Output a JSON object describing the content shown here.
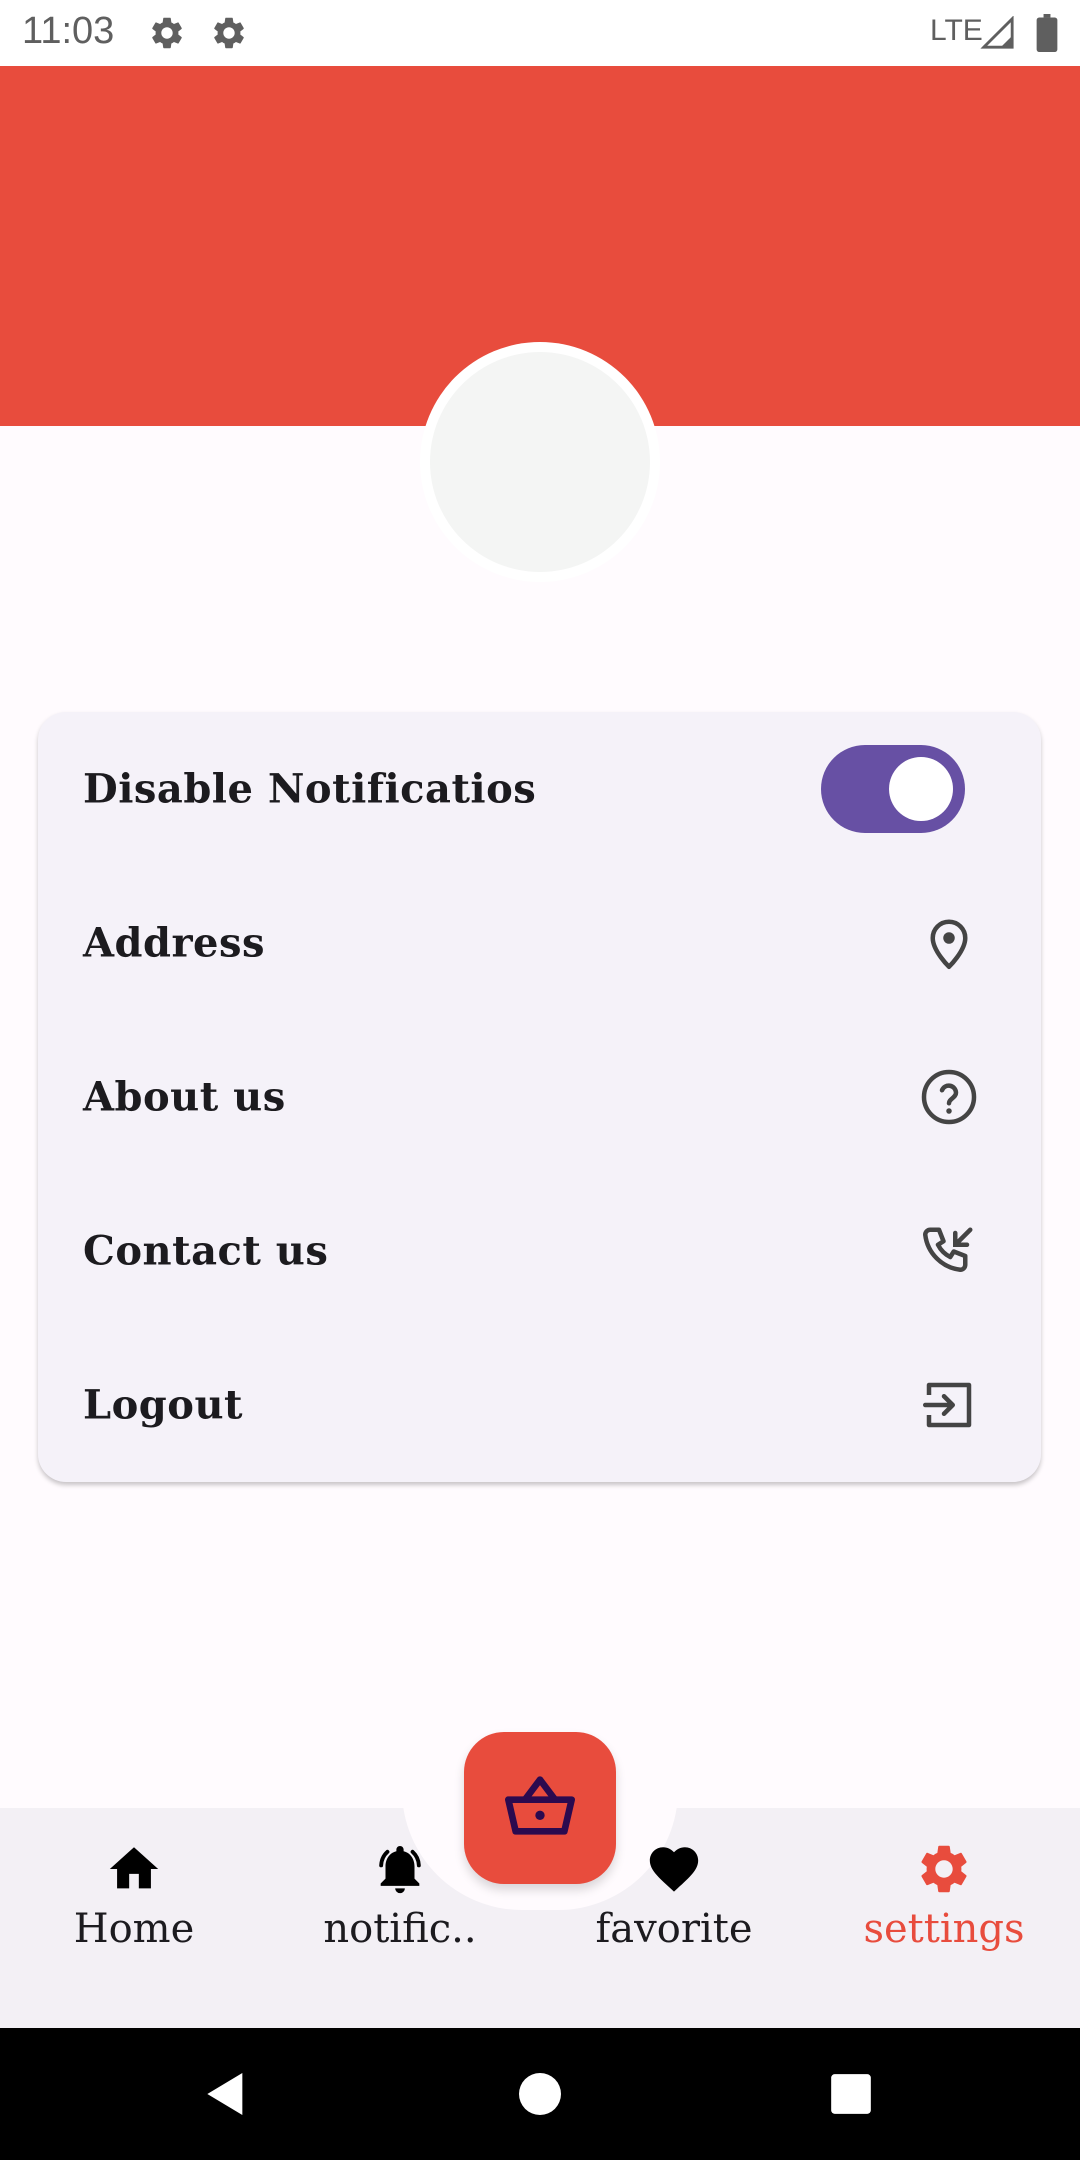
{
  "status_bar": {
    "time": "11:03",
    "network": "LTE"
  },
  "colors": {
    "accent": "#e84c3d",
    "toggle_on": "#6750a4",
    "card_bg": "#f5f2f9",
    "nav_bg": "#f3f0f5"
  },
  "settings": {
    "items": [
      {
        "label": "Disable Notificatios",
        "control": "toggle",
        "toggle_on": true
      },
      {
        "label": "Address",
        "icon": "location-pin-icon"
      },
      {
        "label": "About us",
        "icon": "help-circle-icon"
      },
      {
        "label": "Contact us",
        "icon": "phone-incoming-icon"
      },
      {
        "label": "Logout",
        "icon": "logout-icon"
      }
    ]
  },
  "bottom_nav": {
    "items": [
      {
        "label": "Home",
        "icon": "home-icon",
        "active": false
      },
      {
        "label": "notific..",
        "icon": "bell-icon",
        "active": false
      },
      {
        "label": "favorite",
        "icon": "heart-icon",
        "active": false
      },
      {
        "label": "settings",
        "icon": "gear-icon",
        "active": true
      }
    ],
    "fab_icon": "basket-icon"
  }
}
